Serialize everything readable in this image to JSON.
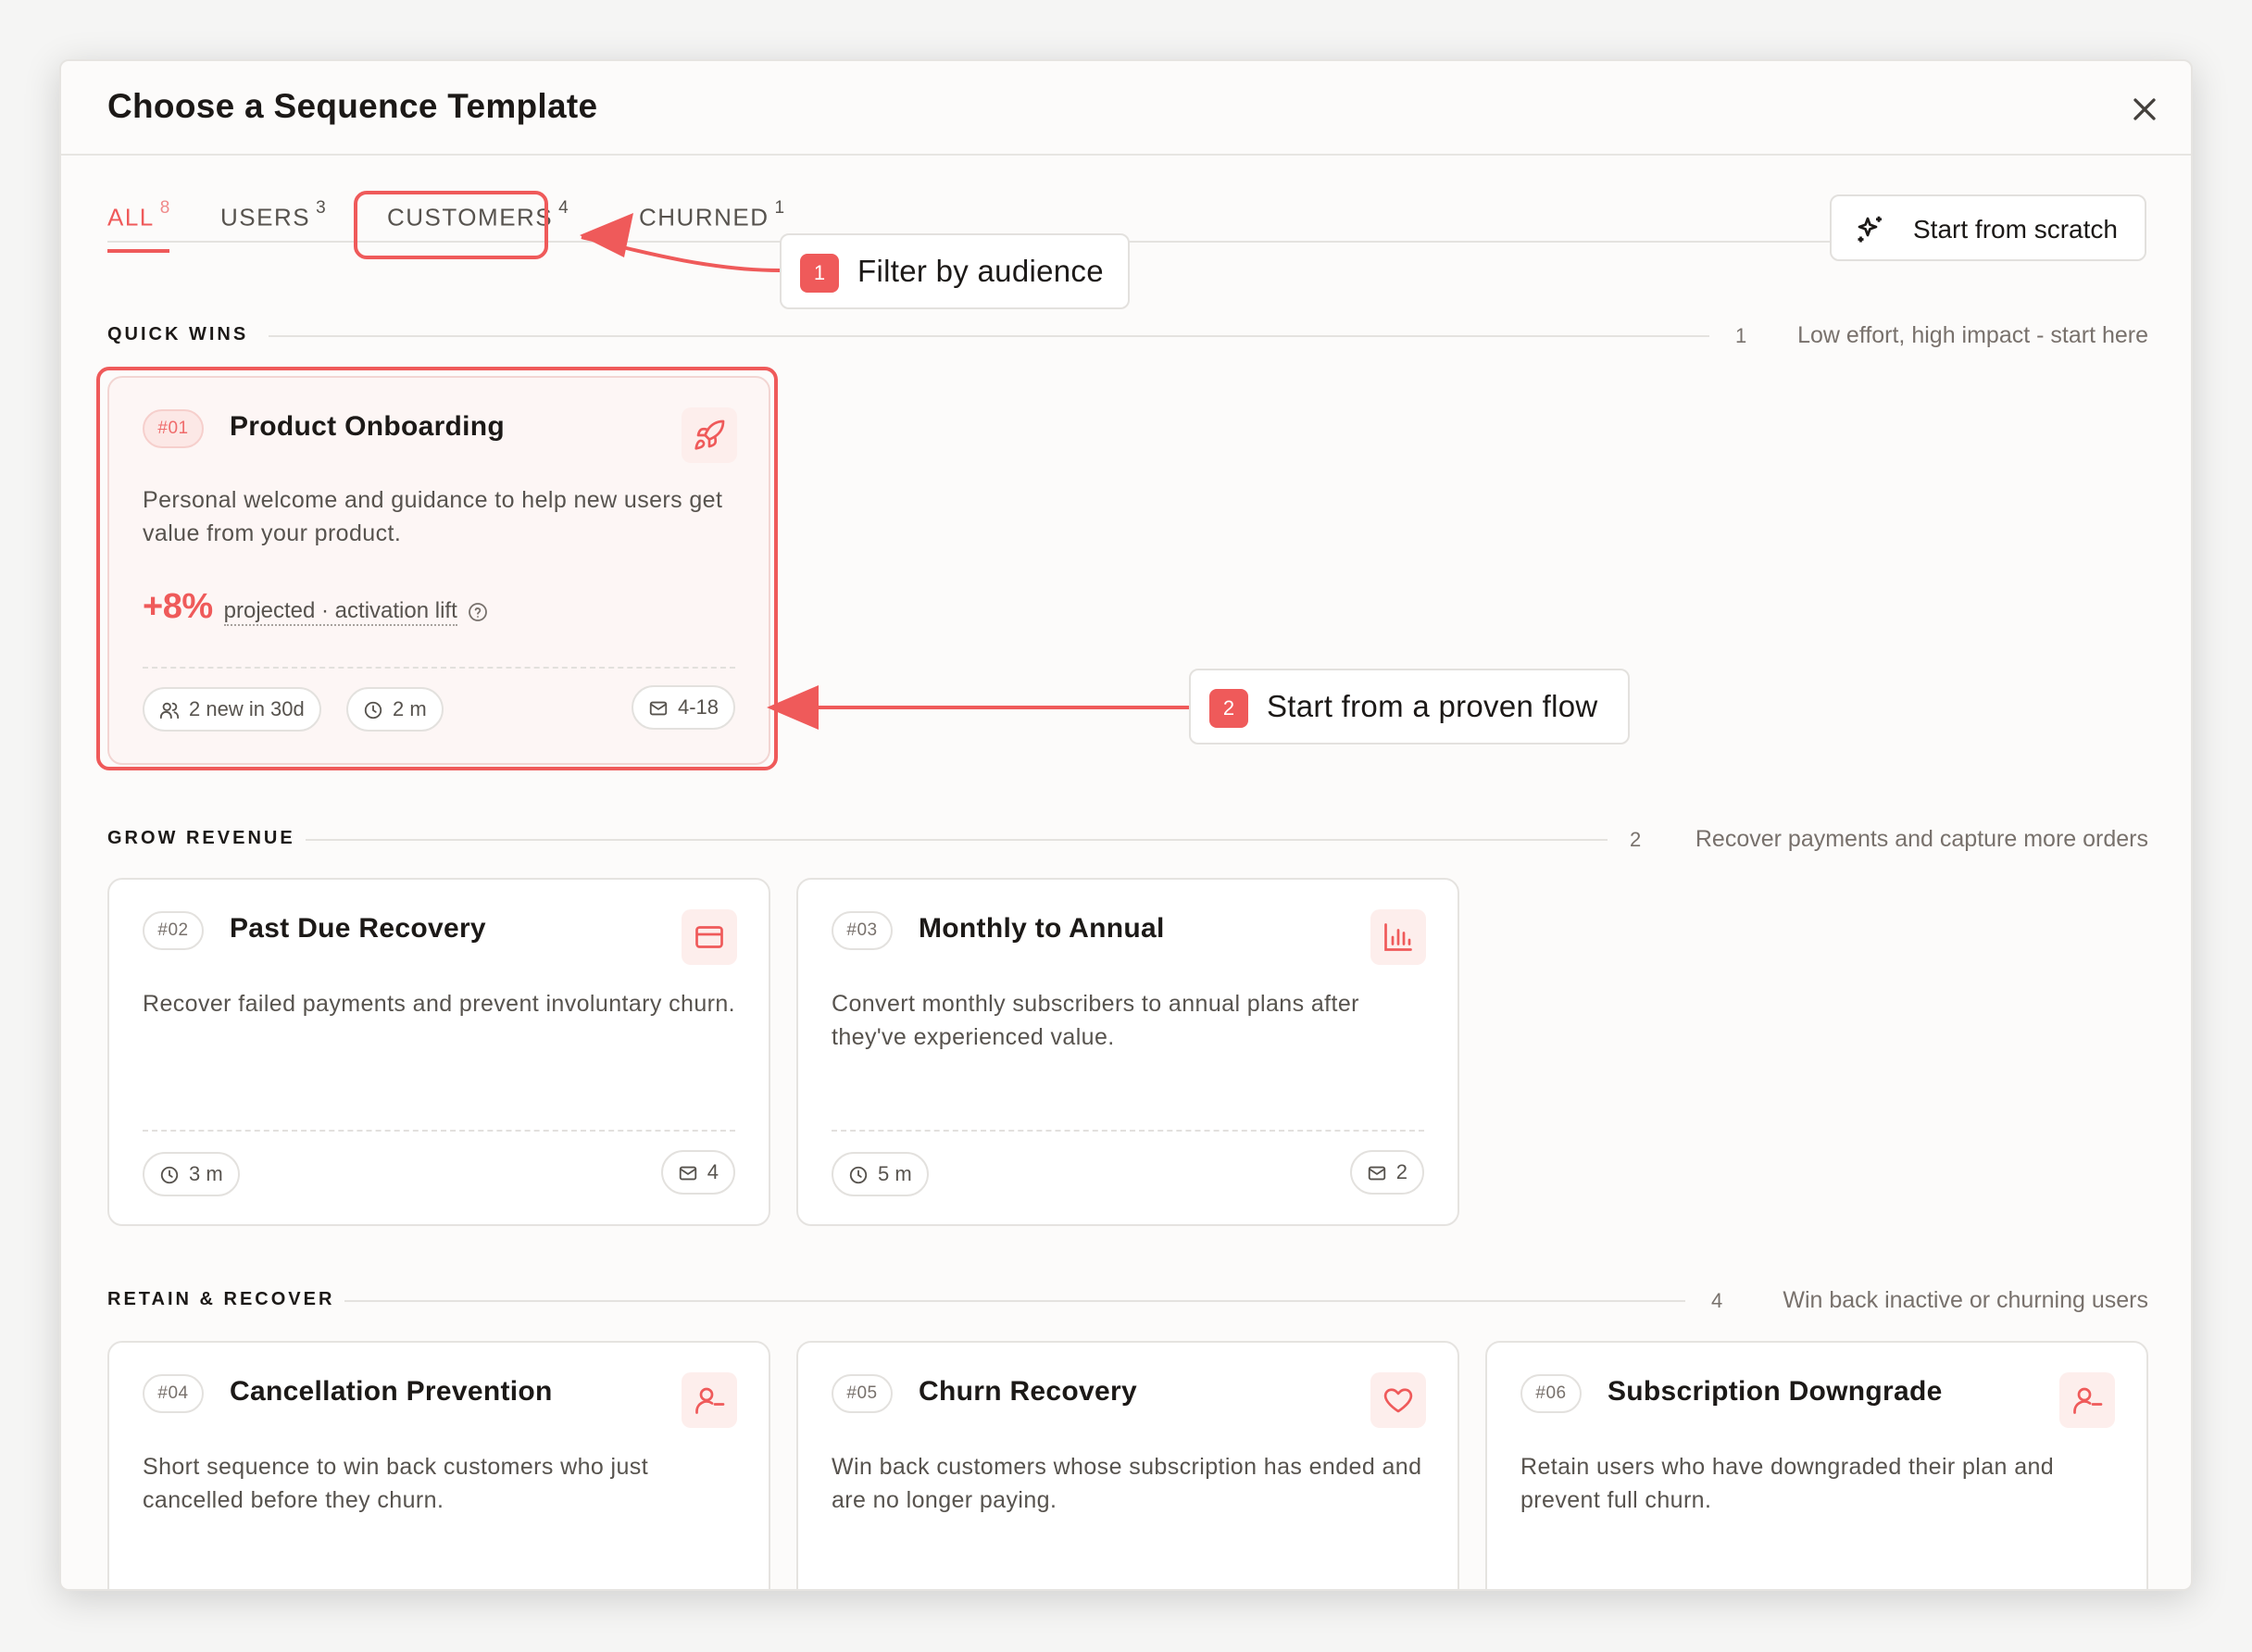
{
  "modal": {
    "title": "Choose a Sequence Template",
    "close_icon": "close-icon"
  },
  "tabs": [
    {
      "label": "ALL",
      "count": "8",
      "active": true
    },
    {
      "label": "USERS",
      "count": "3"
    },
    {
      "label": "CUSTOMERS",
      "count": "4"
    },
    {
      "label": "CHURNED",
      "count": "1"
    }
  ],
  "scratch_button": {
    "label": "Start from scratch",
    "icon": "sparkles-icon"
  },
  "sections": {
    "quick_wins": {
      "name": "QUICK WINS",
      "count": "1",
      "description": "Low effort, high impact - start here"
    },
    "grow_revenue": {
      "name": "GROW REVENUE",
      "count": "2",
      "description": "Recover payments and capture more orders"
    },
    "retain_recover": {
      "name": "RETAIN & RECOVER",
      "count": "4",
      "description": "Win back inactive or churning users"
    }
  },
  "cards": {
    "c01": {
      "num": "#01",
      "title": "Product Onboarding",
      "icon": "rocket-icon",
      "description": "Personal welcome and guidance to help new users get value from your product.",
      "metric_value": "+8%",
      "metric_label": "projected · activation lift",
      "users_chip": "2 new in 30d",
      "time_chip": "2 m",
      "mail_chip": "4-18"
    },
    "c02": {
      "num": "#02",
      "title": "Past Due Recovery",
      "icon": "credit-card-icon",
      "description": "Recover failed payments and prevent involuntary churn.",
      "time_chip": "3 m",
      "mail_chip": "4"
    },
    "c03": {
      "num": "#03",
      "title": "Monthly to Annual",
      "icon": "bar-chart-icon",
      "description": "Convert monthly subscribers to annual plans after they've experienced value.",
      "time_chip": "5 m",
      "mail_chip": "2"
    },
    "c04": {
      "num": "#04",
      "title": "Cancellation Prevention",
      "icon": "user-minus-icon",
      "description": "Short sequence to win back customers who just cancelled before they churn."
    },
    "c05": {
      "num": "#05",
      "title": "Churn Recovery",
      "icon": "heart-icon",
      "description": "Win back customers whose subscription has ended and are no longer paying."
    },
    "c06": {
      "num": "#06",
      "title": "Subscription Downgrade",
      "icon": "user-minus-icon",
      "description": "Retain users who have downgraded their plan and prevent full churn."
    }
  },
  "callouts": {
    "one": {
      "badge": "1",
      "text": "Filter by audience"
    },
    "two": {
      "badge": "2",
      "text": "Start from a proven flow"
    }
  },
  "colors": {
    "accent": "#ef5a5a",
    "tile_bg": "#fdeeec",
    "card_highlight_bg": "#fdf6f5"
  }
}
